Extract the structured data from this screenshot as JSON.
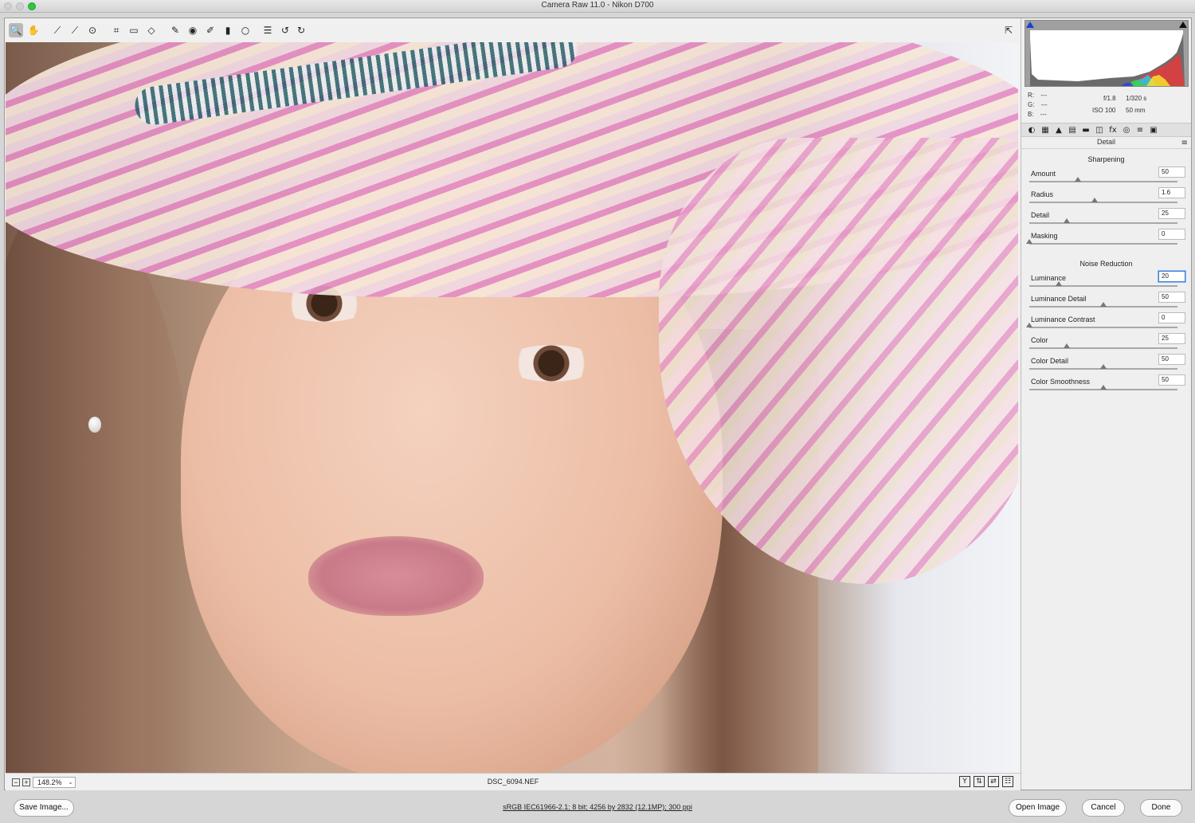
{
  "window": {
    "title": "Camera Raw 11.0  -  Nikon D700"
  },
  "toolbar": {
    "tools": [
      {
        "name": "zoom-tool",
        "glyph": "🔍",
        "active": true
      },
      {
        "name": "hand-tool",
        "glyph": "✋"
      },
      {
        "name": "white-balance-tool",
        "glyph": "⟋"
      },
      {
        "name": "color-sampler-tool",
        "glyph": "⟋"
      },
      {
        "name": "targeted-adjustment-tool",
        "glyph": "⊙"
      },
      {
        "name": "crop-tool",
        "glyph": "⌗"
      },
      {
        "name": "straighten-tool",
        "glyph": "▭"
      },
      {
        "name": "transform-tool",
        "glyph": "◇"
      },
      {
        "name": "spot-removal-tool",
        "glyph": "✎"
      },
      {
        "name": "red-eye-tool",
        "glyph": "◉"
      },
      {
        "name": "adjustment-brush-tool",
        "glyph": "✐"
      },
      {
        "name": "graduated-filter-tool",
        "glyph": "▮"
      },
      {
        "name": "radial-filter-tool",
        "glyph": "○"
      },
      {
        "name": "preferences-tool",
        "glyph": "☰"
      },
      {
        "name": "rotate-left-tool",
        "glyph": "↺"
      },
      {
        "name": "rotate-right-tool",
        "glyph": "↻"
      }
    ],
    "fullscreen_glyph": "⇱"
  },
  "preview": {
    "zoom_out": "−",
    "zoom_in": "+",
    "zoom_level": "148.2%",
    "filename": "DSC_6094.NEF",
    "icons": [
      {
        "name": "before-after-y-icon",
        "glyph": "Y"
      },
      {
        "name": "swap-settings-icon",
        "glyph": "⇅"
      },
      {
        "name": "copy-settings-icon",
        "glyph": "⇄"
      },
      {
        "name": "toggle-settings-icon",
        "glyph": "☷"
      }
    ]
  },
  "readout": {
    "r": "R:",
    "r_val": "---",
    "g": "G:",
    "g_val": "---",
    "b": "B:",
    "b_val": "---",
    "aperture": "f/1.8",
    "shutter": "1/320 s",
    "iso": "ISO 100",
    "focal": "50 mm"
  },
  "panel_tabs": [
    "◐",
    "▦",
    "▲",
    "▤",
    "▬",
    "◫",
    "fx",
    "◎",
    "≡",
    "▣"
  ],
  "panel": {
    "title": "Detail",
    "menu_glyph": "≡",
    "sharpening_head": "Sharpening",
    "noise_head": "Noise Reduction",
    "sharpening": [
      {
        "label": "Amount",
        "value": "50",
        "level": 0.33
      },
      {
        "label": "Radius",
        "value": "1.6",
        "level": 0.44
      },
      {
        "label": "Detail",
        "value": "25",
        "level": 0.25
      },
      {
        "label": "Masking",
        "value": "0",
        "level": 0.0
      }
    ],
    "noise": [
      {
        "label": "Luminance",
        "value": "20",
        "level": 0.2,
        "focus": true
      },
      {
        "label": "Luminance Detail",
        "value": "50",
        "level": 0.5
      },
      {
        "label": "Luminance Contrast",
        "value": "0",
        "level": 0.0
      },
      {
        "label": "Color",
        "value": "25",
        "level": 0.25
      },
      {
        "label": "Color Detail",
        "value": "50",
        "level": 0.5
      },
      {
        "label": "Color Smoothness",
        "value": "50",
        "level": 0.5
      }
    ]
  },
  "bottom": {
    "save_label": "Save Image...",
    "workflow_link": "sRGB IEC61966-2.1; 8 bit; 4256 by 2832 (12.1MP); 300 ppi",
    "open_label": "Open Image",
    "cancel_label": "Cancel",
    "done_label": "Done"
  },
  "colors": {
    "focus_ring": "#3b7fd6",
    "traffic_green": "#2bc840",
    "clip_shadow": "#1a3fd0"
  }
}
